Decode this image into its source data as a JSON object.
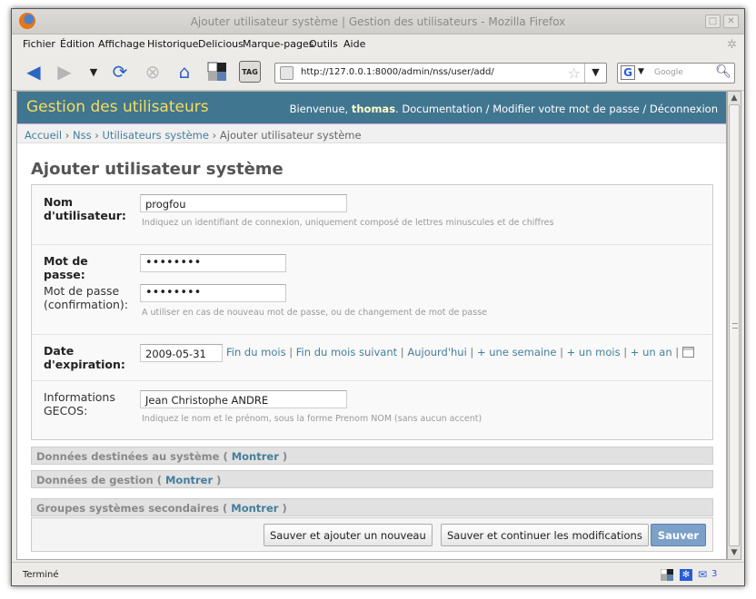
{
  "window": {
    "title": "Ajouter utilisateur système | Gestion des utilisateurs - Mozilla Firefox",
    "btn_min": "□",
    "btn_close": "✕"
  },
  "menu": [
    "Fichier",
    "Édition",
    "Affichage",
    "Historique",
    "Delicious",
    "Marque-pages",
    "Outils",
    "Aide"
  ],
  "nav": {
    "url": "http://127.0.0.1:8000/admin/nss/user/add/",
    "search_placeholder": "Google",
    "tag_label": "TAG"
  },
  "header": {
    "brand": "Gestion des utilisateurs",
    "welcome": "Bienvenue, ",
    "user": "thomas",
    "links": "Documentation / Modifier votre mot de passe / Déconnexion"
  },
  "breadcrumbs": {
    "home": "Accueil",
    "app": "Nss",
    "model": "Utilisateurs système",
    "current": "Ajouter utilisateur système"
  },
  "page_title": "Ajouter utilisateur système",
  "form": {
    "username": {
      "label_1": "Nom",
      "label_2": "d'utilisateur:",
      "value": "progfou",
      "help": "Indiquez un identifiant de connexion, uniquement composé de lettres minuscules et de chiffres"
    },
    "password": {
      "label_1": "Mot de",
      "label_2": "passe:",
      "value": "••••••••"
    },
    "password2": {
      "label_1": "Mot de passe",
      "label_2": "(confirmation):",
      "value": "••••••••",
      "help": "A utiliser en cas de nouveau mot de passe, ou de changement de mot de passe"
    },
    "expiration": {
      "label_1": "Date",
      "label_2": "d'expiration:",
      "value": "2009-05-31",
      "shortcuts": [
        "Fin du mois",
        "Fin du mois suivant",
        "Aujourd'hui",
        "+ une semaine",
        "+ un mois",
        "+ un an"
      ]
    },
    "gecos": {
      "label_1": "Informations",
      "label_2": "GECOS:",
      "value": "Jean Christophe ANDRE",
      "help": "Indiquez le nom et le prénom, sous la forme Prenom NOM (sans aucun accent)"
    }
  },
  "collapsed": [
    {
      "title": "Données destinées au système",
      "link": "Montrer"
    },
    {
      "title": "Données de gestion",
      "link": "Montrer"
    },
    {
      "title": "Groupes systèmes secondaires",
      "link": "Montrer"
    }
  ],
  "buttons": {
    "save_add": "Sauver et ajouter un nouveau",
    "save_continue": "Sauver et continuer les modifications",
    "save": "Sauver"
  },
  "status": {
    "text": "Terminé",
    "mail_count": "3"
  }
}
